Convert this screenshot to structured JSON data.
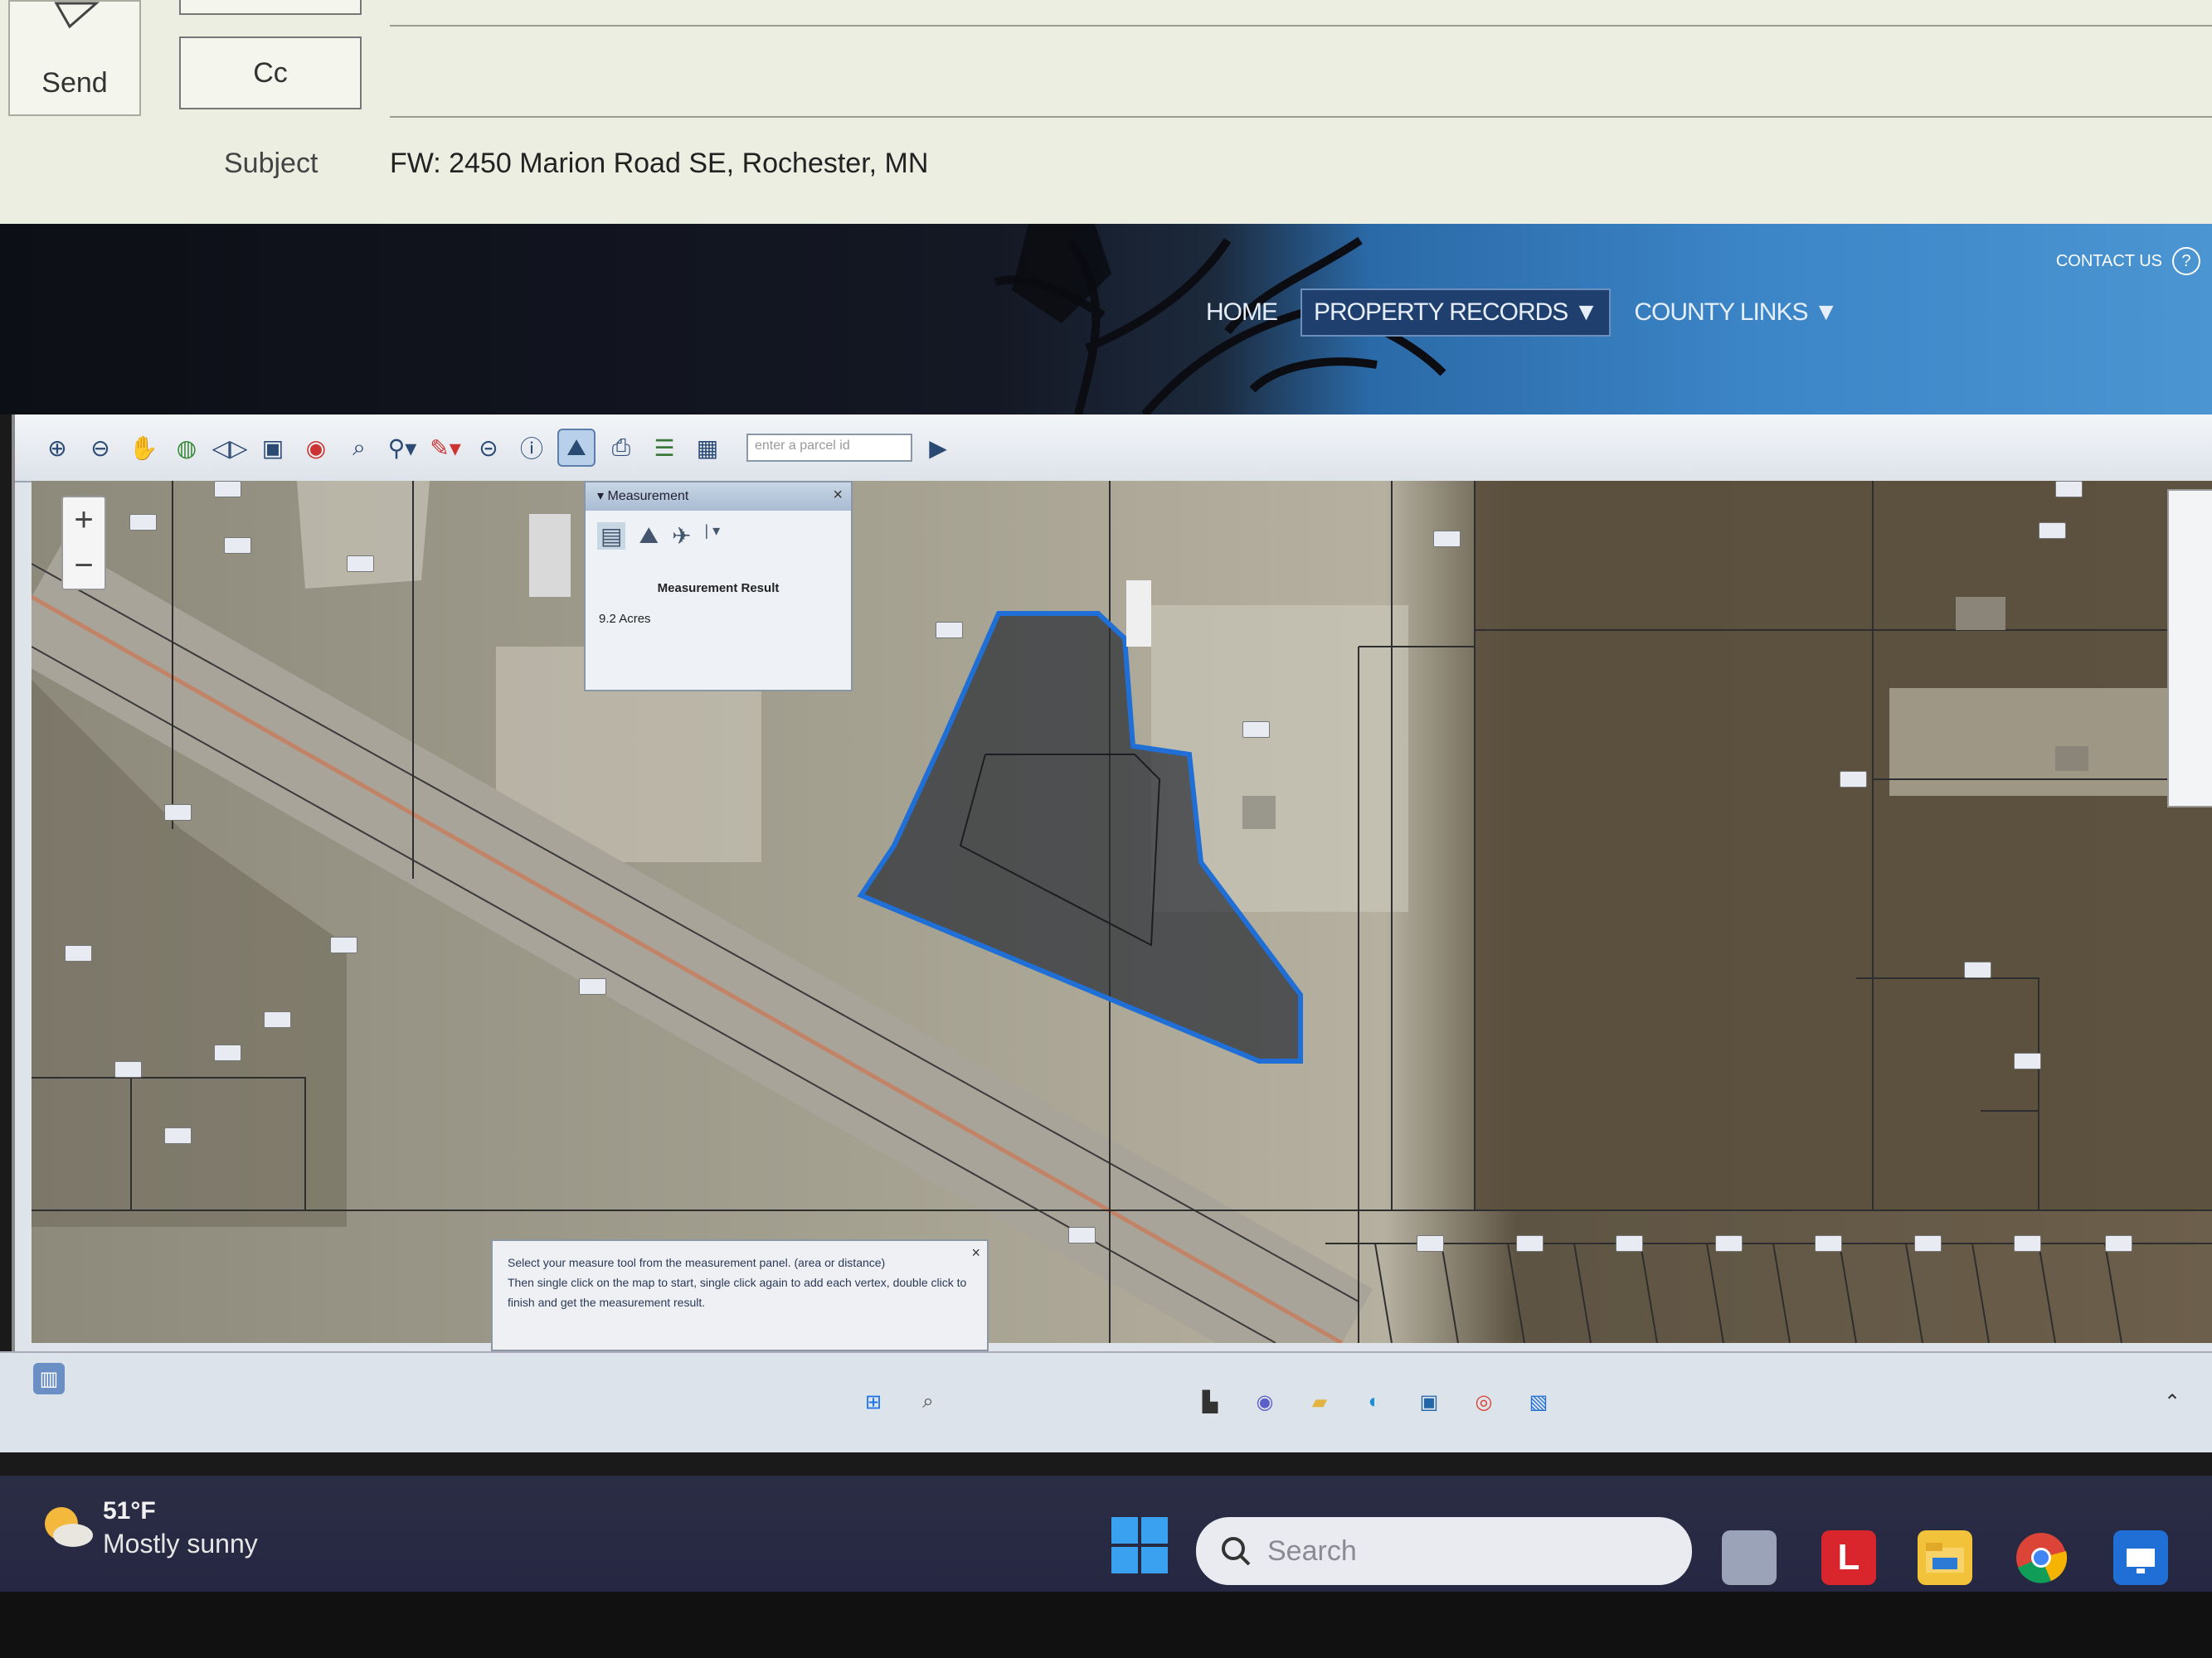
{
  "mail": {
    "send_label": "Send",
    "cc_label": "Cc",
    "subject_label": "Subject",
    "subject_value": "FW: 2450 Marion Road SE, Rochester, MN"
  },
  "site": {
    "contact": "CONTACT US",
    "help": "?",
    "nav": [
      {
        "label": "HOME"
      },
      {
        "label": "PROPERTY RECORDS ▼"
      },
      {
        "label": "COUNTY LINKS ▼"
      }
    ]
  },
  "gis": {
    "toolbar_icons": [
      "zoom-in-icon",
      "zoom-out-icon",
      "pan-icon",
      "globe-icon",
      "back-forward-icon",
      "full-extent-icon",
      "select-icon",
      "zoom-rect-icon",
      "identify-icon",
      "draw-icon",
      "clear-icon",
      "info-icon",
      "measure-icon",
      "print-icon",
      "layers-icon",
      "basemap-icon"
    ],
    "search_placeholder": "enter a parcel id",
    "zoom": {
      "plus": "+",
      "minus": "−"
    },
    "measure": {
      "title": "Measurement",
      "result_title": "Measurement Result",
      "result_value": "9.2 Acres"
    },
    "tooltip": {
      "line1": "Select your measure tool from the measurement panel. (area or distance)",
      "line2": "Then single click on the map to start, single click again to add each vertex, double click to finish and get the measurement result."
    },
    "colors": {
      "parcel_outline": "#1f6fd6",
      "road": "#c87a5a"
    }
  },
  "weather": {
    "temp": "51°F",
    "desc": "Mostly sunny"
  },
  "taskbar": {
    "search_placeholder": "Search"
  }
}
